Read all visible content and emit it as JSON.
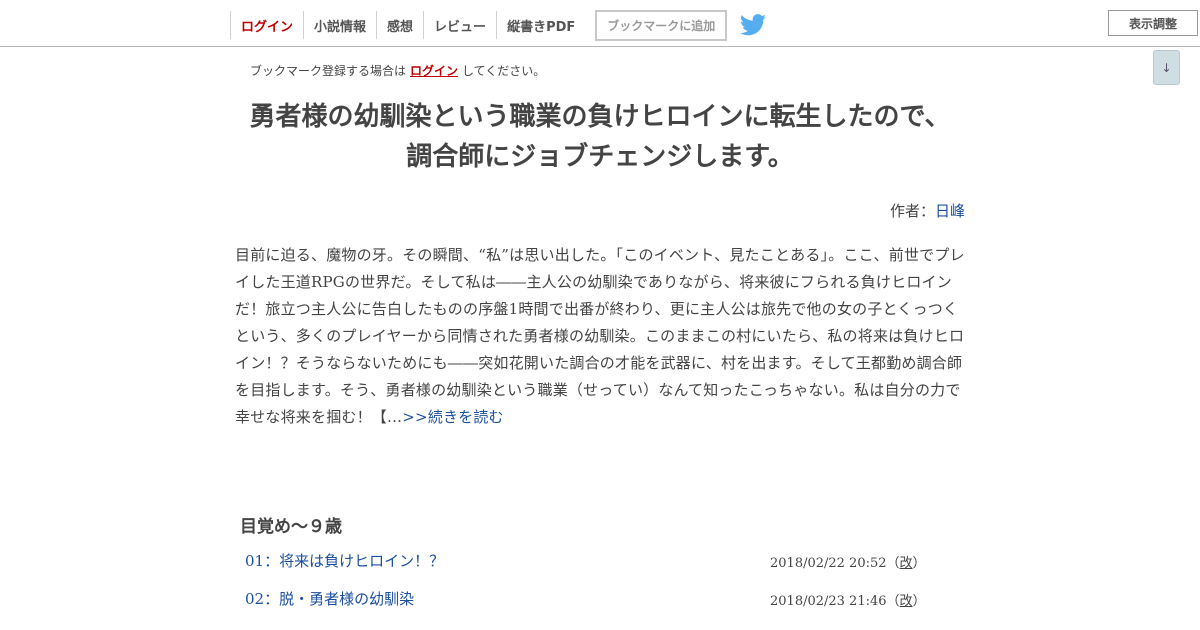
{
  "nav": {
    "login": "ログイン",
    "novel_info": "小説情報",
    "impressions": "感想",
    "review": "レビュー",
    "vertical_pdf": "縦書きPDF",
    "bookmark_button": "ブックマークに追加",
    "display_settings": "表示調整",
    "scroll_arrow": "↓"
  },
  "notice": {
    "before": "ブックマーク登録する場合は",
    "link": "ログイン",
    "after": "してください。"
  },
  "novel": {
    "title": "勇者様の幼馴染という職業の負けヒロインに転生したので、調合師にジョブチェンジします。",
    "author_label": "作者：",
    "author_name": "日峰",
    "summary": "目前に迫る、魔物の牙。その瞬間、“私”は思い出した。「このイベント、見たことある」。ここ、前世でプレイした王道RPGの世界だ。そして私は――主人公の幼馴染でありながら、将来彼にフられる負けヒロインだ！旅立つ主人公に告白したものの序盤1時間で出番が終わり、更に主人公は旅先で他の女の子とくっつくという、多くのプレイヤーから同情された勇者様の幼馴染。このままこの村にいたら、私の将来は負けヒロイン！？そうならないためにも――突如花開いた調合の才能を武器に、村を出ます。そして王都勤め調合師を目指します。そう、勇者様の幼馴染という職業（せってい）なんて知ったこっちゃない。私は自分の力で幸せな将来を掴む！【…",
    "read_more": ">>続きを読む"
  },
  "chapter": {
    "title": "目覚め〜９歳",
    "episodes": [
      {
        "title": "01：将来は負けヒロイン！？",
        "date": "2018/02/22 20:52",
        "rev": "改"
      },
      {
        "title": "02：脱・勇者様の幼馴染",
        "date": "2018/02/23 21:46",
        "rev": "改"
      }
    ]
  },
  "colors": {
    "login_red": "#c00000",
    "link_blue": "#1b4fa0",
    "twitter_blue": "#55acee"
  }
}
